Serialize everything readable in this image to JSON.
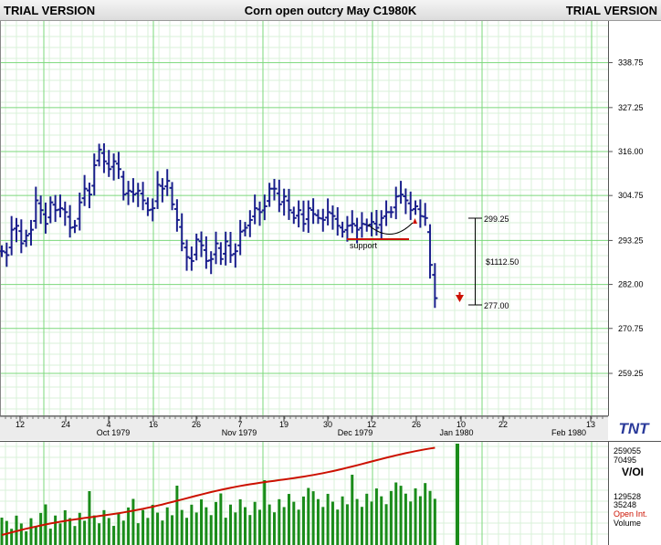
{
  "header": {
    "left_label": "TRIAL VERSION",
    "title": "Corn open outcry May C1980K",
    "right_label": "TRIAL VERSION"
  },
  "colors": {
    "bars": "#1a1f8c",
    "grid_major": "#7bd87b",
    "grid_minor": "#d9f2d9",
    "oi_line": "#cc1100",
    "volume": "#1a8c1a",
    "annotation": "#cc1100"
  },
  "chart_data": {
    "type": "ohlc",
    "title": "Corn open outcry May C1980K",
    "y_axis": {
      "ticks": [
        "338.75",
        "327.25",
        "316.00",
        "304.75",
        "293.25",
        "282.00",
        "270.75",
        "259.25"
      ],
      "range": [
        251,
        352
      ]
    },
    "x_axis": {
      "day_labels": [
        "12",
        "24",
        "4",
        "16",
        "26",
        "7",
        "19",
        "30",
        "12",
        "26",
        "10",
        "22",
        "13"
      ],
      "month_labels": [
        "Oct 1979",
        "Nov 1979",
        "Dec 1979",
        "Jan 1980",
        "Feb 1980"
      ]
    },
    "price_bars_close": [
      290.5,
      289.5,
      296.0,
      297.0,
      292.5,
      294.5,
      296.0,
      303.5,
      301.0,
      297.5,
      303.0,
      301.0,
      301.5,
      300.5,
      296.5,
      297.0,
      303.0,
      306.5,
      305.0,
      312.5,
      316.5,
      313.5,
      311.5,
      313.5,
      311.5,
      305.0,
      306.0,
      305.0,
      306.0,
      303.5,
      301.0,
      301.5,
      307.5,
      306.5,
      308.5,
      302.5,
      298.5,
      292.5,
      289.0,
      288.0,
      293.5,
      292.0,
      288.0,
      288.5,
      292.5,
      288.5,
      293.0,
      289.5,
      290.5,
      295.5,
      296.5,
      298.5,
      301.5,
      300.5,
      302.0,
      306.5,
      306.5,
      302.5,
      304.5,
      301.0,
      299.0,
      301.0,
      297.5,
      301.5,
      300.0,
      299.0,
      298.5,
      300.5,
      299.5,
      297.0,
      295.5,
      297.0,
      297.5,
      296.0,
      297.5,
      297.0,
      298.0,
      296.5,
      299.0,
      300.5,
      300.5,
      304.5,
      305.0,
      303.5,
      301.0,
      302.0,
      299.5,
      299.0,
      287.0,
      278.5
    ],
    "price_label": "$1112.50",
    "range_high": "299.25",
    "range_low": "277.00",
    "annotation": "support",
    "volume_axis": [
      "259055",
      "70495",
      "129528",
      "35248"
    ],
    "volume_labels": {
      "vol_oi": "V/OI",
      "open_int": "Open Int.",
      "volume": "Volume"
    }
  }
}
